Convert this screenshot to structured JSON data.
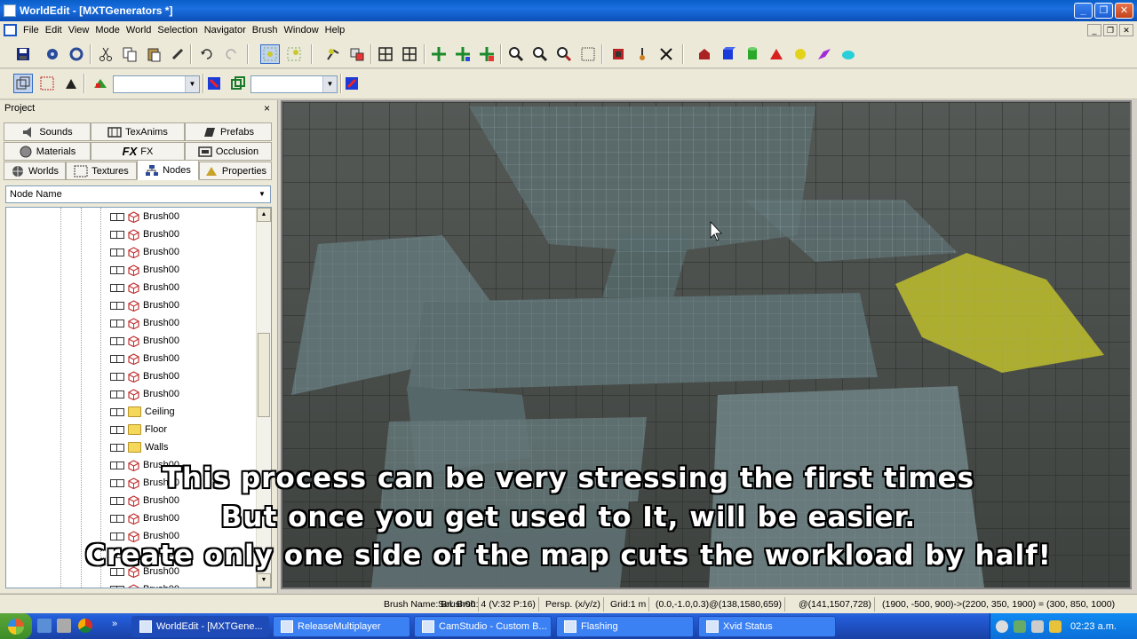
{
  "window": {
    "title": "WorldEdit - [MXTGenerators *]"
  },
  "menu": [
    "File",
    "Edit",
    "View",
    "Mode",
    "World",
    "Selection",
    "Navigator",
    "Brush",
    "Window",
    "Help"
  ],
  "project": {
    "title": "Project",
    "close": "×",
    "tabs_row1": [
      "Sounds",
      "TexAnims",
      "Prefabs"
    ],
    "tabs_row2": [
      "Materials",
      "FX",
      "Occlusion"
    ],
    "tabs_row3": [
      "Worlds",
      "Textures",
      "Nodes",
      "Properties"
    ],
    "active_tab": "Nodes",
    "node_combo": "Node Name",
    "tree_items": [
      {
        "label": "Brush00",
        "kind": "brush"
      },
      {
        "label": "Brush00",
        "kind": "brush"
      },
      {
        "label": "Brush00",
        "kind": "brush"
      },
      {
        "label": "Brush00",
        "kind": "brush"
      },
      {
        "label": "Brush00",
        "kind": "brush"
      },
      {
        "label": "Brush00",
        "kind": "brush"
      },
      {
        "label": "Brush00",
        "kind": "brush"
      },
      {
        "label": "Brush00",
        "kind": "brush"
      },
      {
        "label": "Brush00",
        "kind": "brush"
      },
      {
        "label": "Brush00",
        "kind": "brush"
      },
      {
        "label": "Brush00",
        "kind": "brush"
      },
      {
        "label": "Ceiling",
        "kind": "folder"
      },
      {
        "label": "Floor",
        "kind": "folder"
      },
      {
        "label": "Walls",
        "kind": "folder"
      },
      {
        "label": "Brush00",
        "kind": "brush"
      },
      {
        "label": "Brush00",
        "kind": "brush"
      },
      {
        "label": "Brush00",
        "kind": "brush"
      },
      {
        "label": "Brush00",
        "kind": "brush"
      },
      {
        "label": "Brush00",
        "kind": "brush"
      },
      {
        "label": "Brush00",
        "kind": "brush"
      },
      {
        "label": "Brush00",
        "kind": "brush"
      },
      {
        "label": "Brush00",
        "kind": "brush"
      }
    ]
  },
  "captions": [
    "This process can be very stressing the first times",
    "But once you get used to It, will be easier.",
    "Create only one side of the map cuts the workload by half!"
  ],
  "status": {
    "brush_name": "Brush Name: Brush00",
    "sel": "Sel: Brsh: 4 (V:32 P:16)",
    "persp": "Persp. (x/y/z)",
    "grid": "Grid:1 m",
    "vec": "(0.0,-1.0,0.3)@(138,1580,659)",
    "pos": "@(141,1507,728)",
    "bounds": "(1900, -500, 900)->(2200, 350, 1900) = (300, 850, 1000)"
  },
  "taskbar": {
    "tasks": [
      "WorldEdit - [MXTGene...",
      "ReleaseMultiplayer",
      "CamStudio - Custom B...",
      "Flashing",
      "Xvid Status"
    ],
    "clock": "02:23 a.m."
  },
  "colors": {
    "title_blue": "#0a5ec8",
    "selection_yellow": "#c8c832",
    "taskbar_blue": "#245edb"
  }
}
